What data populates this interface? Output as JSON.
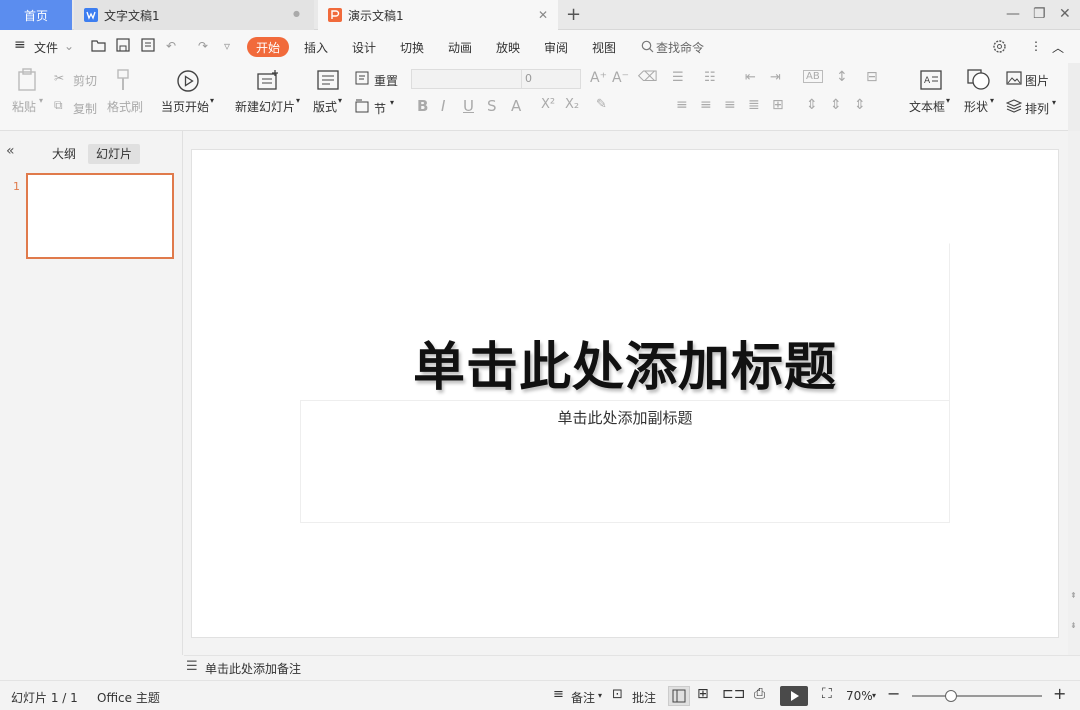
{
  "tabs": {
    "home": "首页",
    "writer": "文字文稿1",
    "presentation": "演示文稿1",
    "add": "+"
  },
  "menu": {
    "file": "文件",
    "start": "开始",
    "insert": "插入",
    "design": "设计",
    "transition": "切换",
    "animation": "动画",
    "slideshow": "放映",
    "review": "审阅",
    "view": "视图",
    "search": "查找命令"
  },
  "ribbon": {
    "paste": "粘贴",
    "cut": "剪切",
    "copy": "复制",
    "format_painter": "格式刷",
    "from_current": "当页开始",
    "new_slide": "新建幻灯片",
    "layout": "版式",
    "reset": "重置",
    "section": "节",
    "font_size": "0",
    "textbox": "文本框",
    "shape": "形状",
    "picture": "图片",
    "arrange": "排列"
  },
  "panel": {
    "outline_tab": "大纲",
    "slides_tab": "幻灯片",
    "slide_number": "1"
  },
  "slide": {
    "title_placeholder": "单击此处添加标题",
    "subtitle_placeholder": "单击此处添加副标题"
  },
  "notes": {
    "placeholder": "单击此处添加备注"
  },
  "status": {
    "slide_count": "幻灯片 1 / 1",
    "theme": "Office 主题",
    "notes": "备注",
    "comments": "批注",
    "zoom": "70%",
    "zoom_level": 0.3
  },
  "colors": {
    "accent": "#f16a3b",
    "home_tab": "#5b8def",
    "thumb_border": "#e07a4b"
  }
}
